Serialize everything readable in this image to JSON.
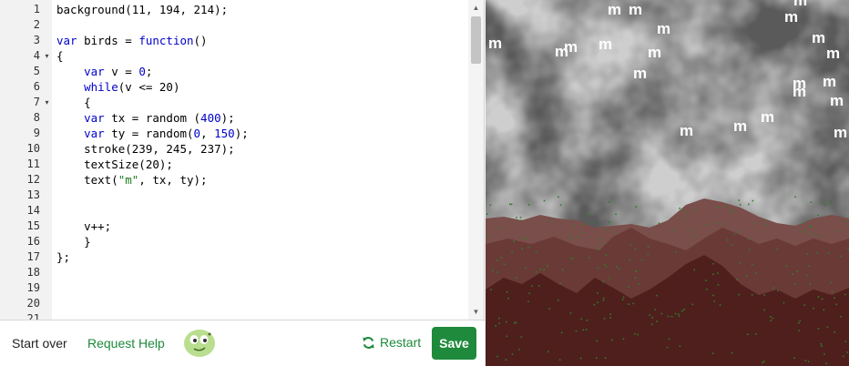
{
  "editor": {
    "lines": [
      {
        "n": "1"
      },
      {
        "n": "2"
      },
      {
        "n": "3"
      },
      {
        "n": "4"
      },
      {
        "n": "5"
      },
      {
        "n": "6"
      },
      {
        "n": "7"
      },
      {
        "n": "8"
      },
      {
        "n": "9"
      },
      {
        "n": "10"
      },
      {
        "n": "11"
      },
      {
        "n": "12"
      },
      {
        "n": "13"
      },
      {
        "n": "14"
      },
      {
        "n": "15"
      },
      {
        "n": "16"
      },
      {
        "n": "17"
      },
      {
        "n": "18"
      },
      {
        "n": "19"
      },
      {
        "n": "20"
      },
      {
        "n": "21"
      }
    ],
    "code": {
      "l1": "background(11, 194, 214);",
      "l3_a": "var",
      "l3_b": " birds = ",
      "l3_c": "function",
      "l3_d": "()",
      "l4": "{",
      "l5_a": "    ",
      "l5_b": "var",
      "l5_c": " v = ",
      "l5_d": "0",
      "l5_e": ";",
      "l6_a": "    ",
      "l6_b": "while",
      "l6_c": "(v <= ",
      "l6_d": "20",
      "l6_e": ")",
      "l7": "    {",
      "l8_a": "    ",
      "l8_b": "var",
      "l8_c": " tx = random (",
      "l8_d": "400",
      "l8_e": ");",
      "l9_a": "    ",
      "l9_b": "var",
      "l9_c": " ty = random(",
      "l9_d": "0",
      "l9_e": ", ",
      "l9_f": "150",
      "l9_g": ");",
      "l10": "    stroke(239, 245, 237);",
      "l11": "    textSize(20);",
      "l12_a": "    text(",
      "l12_b": "\"m\"",
      "l12_c": ", tx, ty);",
      "l15": "    v++;",
      "l16": "    }",
      "l17": "};"
    }
  },
  "toolbar": {
    "start_over": "Start over",
    "request_help": "Request Help",
    "restart": "Restart",
    "save": "Save"
  },
  "canvas": {
    "bird_glyph": "m",
    "colors": {
      "sky": "#0bc2d6",
      "cloud_dark": "#5a5a5a",
      "cloud_light": "#cfcfcf",
      "mountain_far": "#7a4e4a",
      "mountain_mid": "#6a3a36",
      "mountain_near": "#4e1f1c",
      "grass": "#2e7d2a",
      "bird": "#ffffff"
    }
  }
}
